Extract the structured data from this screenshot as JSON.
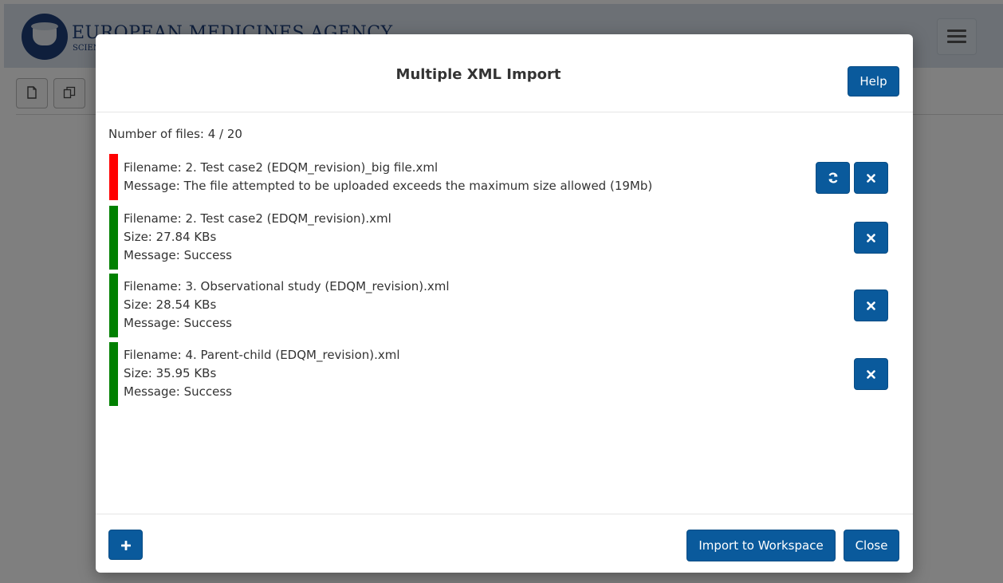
{
  "app": {
    "title": "EUROPEAN MEDICINES AGENCY",
    "subtitle": "SCIENCE MEDICINES HEALTH",
    "toolbar": {
      "new_icon": "file-icon",
      "copy_icon": "copy-icon"
    },
    "menu_icon": "hamburger-icon"
  },
  "modal": {
    "title": "Multiple XML Import",
    "help_label": "Help",
    "file_count": "Number of files: 4 / 20",
    "files": [
      {
        "status": "error",
        "filename": "Filename: 2. Test case2 (EDQM_revision)_big file.xml",
        "message": "Message: The file attempted to be uploaded exceeds the maximum size allowed (19Mb)",
        "actions": [
          "refresh-icon",
          "remove-icon"
        ]
      },
      {
        "status": "success",
        "filename": "Filename: 2. Test case2 (EDQM_revision).xml",
        "size": "Size: 27.84 KBs",
        "message": "Message: Success",
        "actions": [
          "remove-icon"
        ]
      },
      {
        "status": "success",
        "filename": "Filename: 3. Observational study (EDQM_revision).xml",
        "size": "Size: 28.54 KBs",
        "message": "Message: Success",
        "actions": [
          "remove-icon"
        ]
      },
      {
        "status": "success",
        "filename": "Filename: 4. Parent-child (EDQM_revision).xml",
        "size": "Size: 35.95 KBs",
        "message": "Message: Success",
        "actions": [
          "remove-icon"
        ]
      }
    ],
    "footer": {
      "add_icon": "plus-icon",
      "import_label": "Import to Workspace",
      "close_label": "Close"
    }
  },
  "colors": {
    "primary": "#0a5a9c",
    "error": "#ff0000",
    "success": "#008000"
  }
}
